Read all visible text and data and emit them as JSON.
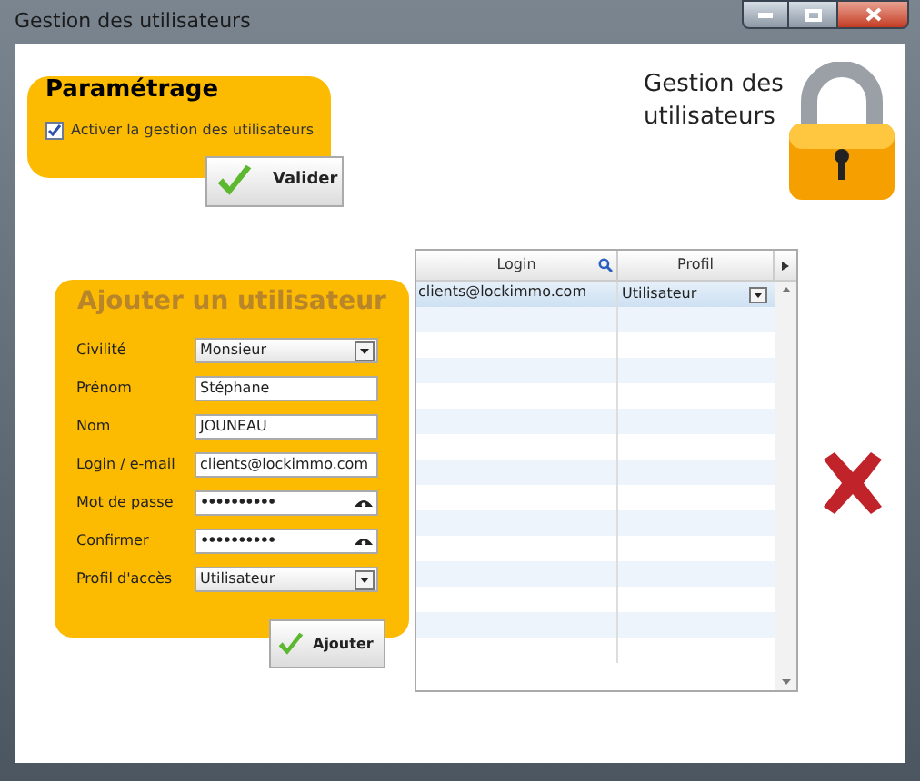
{
  "window": {
    "title": "Gestion des utilisateurs"
  },
  "settings": {
    "title": "Paramétrage",
    "checkbox": {
      "label": "Activer la gestion des utilisateurs",
      "checked": true
    },
    "button": "Valider"
  },
  "header": {
    "title": "Gestion des utilisateurs"
  },
  "form": {
    "title": "Ajouter un utilisateur",
    "fields": [
      {
        "kind": "select",
        "label": "Civilité",
        "value": "Monsieur"
      },
      {
        "kind": "text",
        "label": "Prénom",
        "value": "Stéphane"
      },
      {
        "kind": "text",
        "label": "Nom",
        "value": "JOUNEAU"
      },
      {
        "kind": "text",
        "label": "Login / e-mail",
        "value": "clients@lockimmo.com"
      },
      {
        "kind": "password",
        "label": "Mot de passe",
        "value": "••••••••••"
      },
      {
        "kind": "password",
        "label": "Confirmer",
        "value": "••••••••••"
      },
      {
        "kind": "select",
        "label": "Profil d'accès",
        "value": "Utilisateur"
      }
    ],
    "button": "Ajouter"
  },
  "table": {
    "columns": [
      "Login",
      "Profil"
    ],
    "rows": [
      {
        "login": "clients@lockimmo.com",
        "profil": "Utilisateur",
        "selected": true
      }
    ]
  }
}
